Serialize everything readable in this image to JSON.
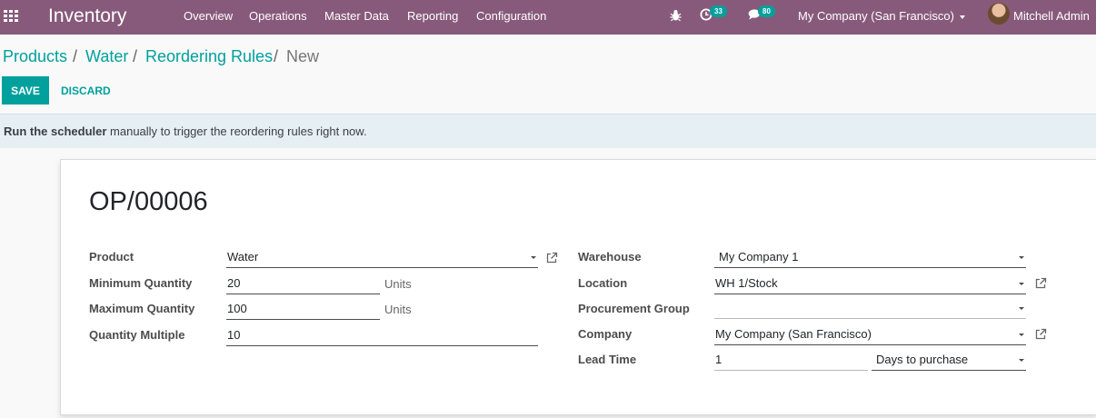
{
  "navbar": {
    "app_name": "Inventory",
    "menu": [
      "Overview",
      "Operations",
      "Master Data",
      "Reporting",
      "Configuration"
    ],
    "activity_count": "33",
    "message_count": "80",
    "company": "My Company (San Francisco)",
    "user": "Mitchell Admin"
  },
  "breadcrumb": {
    "items": [
      "Products",
      "Water",
      "Reordering Rules"
    ],
    "separator": "/",
    "current": "New"
  },
  "buttons": {
    "save": "Save",
    "discard": "Discard"
  },
  "alert": {
    "bold": "Run the scheduler",
    "rest": " manually to trigger the reordering rules right now."
  },
  "form": {
    "title": "OP/00006",
    "left": {
      "product": {
        "label": "Product",
        "value": "Water"
      },
      "min_qty": {
        "label": "Minimum Quantity",
        "value": "20",
        "unit": "Units"
      },
      "max_qty": {
        "label": "Maximum Quantity",
        "value": "100",
        "unit": "Units"
      },
      "qty_multiple": {
        "label": "Quantity Multiple",
        "value": "10"
      }
    },
    "right": {
      "warehouse": {
        "label": "Warehouse",
        "value": "My Company 1"
      },
      "location": {
        "label": "Location",
        "value": "WH 1/Stock"
      },
      "procurement_group": {
        "label": "Procurement Group",
        "value": ""
      },
      "company": {
        "label": "Company",
        "value": "My Company (San Francisco)"
      },
      "lead_time": {
        "label": "Lead Time",
        "value": "1",
        "type": "Days to purchase"
      }
    }
  },
  "colors": {
    "navbar": "#875a7b",
    "accent": "#00a09d",
    "alert_bg": "#e6f0f4"
  },
  "icons": [
    "apps-grid-icon",
    "bug-icon",
    "clock-icon",
    "chat-icon",
    "external-link-icon",
    "caret-down-icon"
  ]
}
